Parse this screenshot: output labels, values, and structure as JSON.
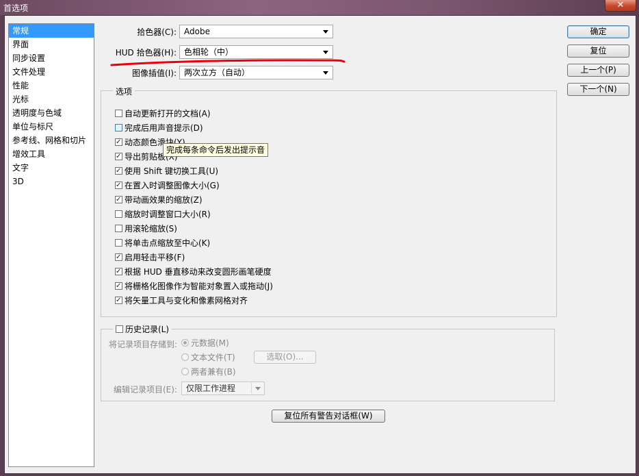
{
  "window": {
    "title": "首选项",
    "close_glyph": "✕"
  },
  "nav": {
    "items": [
      "常规",
      "界面",
      "同步设置",
      "文件处理",
      "性能",
      "光标",
      "透明度与色域",
      "单位与标尺",
      "参考线、网格和切片",
      "增效工具",
      "文字",
      "3D"
    ],
    "selected": 0
  },
  "general": {
    "color_picker": {
      "label": "拾色器(C):",
      "value": "Adobe"
    },
    "hud_picker": {
      "label": "HUD 拾色器(H):",
      "value": "色相轮（中）"
    },
    "interpolation": {
      "label": "图像插值(I):",
      "value": "两次立方（自动）"
    }
  },
  "options": {
    "title": "选项",
    "checks": [
      {
        "label": "自动更新打开的文档(A)",
        "checked": false
      },
      {
        "label": "完成后用声音提示(D)",
        "checked": false,
        "hover": true
      },
      {
        "label": "动态颜色滑块(Y)",
        "checked": true
      },
      {
        "label": "导出剪贴板(X)",
        "checked": true
      },
      {
        "label": "使用 Shift 键切换工具(U)",
        "checked": true
      },
      {
        "label": "在置入时调整图像大小(G)",
        "checked": true
      },
      {
        "label": "带动画效果的缩放(Z)",
        "checked": true
      },
      {
        "label": "缩放时调整窗口大小(R)",
        "checked": false
      },
      {
        "label": "用滚轮缩放(S)",
        "checked": false
      },
      {
        "label": "将单击点缩放至中心(K)",
        "checked": false
      },
      {
        "label": "启用轻击平移(F)",
        "checked": true
      },
      {
        "label": "根据 HUD 垂直移动来改变圆形画笔硬度",
        "checked": true
      },
      {
        "label": "将栅格化图像作为智能对象置入或拖动(J)",
        "checked": true
      },
      {
        "label": "将矢量工具与变化和像素网格对齐",
        "checked": true
      }
    ],
    "tooltip": "完成每条命令后发出提示音"
  },
  "history": {
    "label": "历史记录(L)",
    "checked": false,
    "save_to_label": "将记录项目存储到:",
    "radios": [
      {
        "label": "元数据(M)",
        "on": true
      },
      {
        "label": "文本文件(T)",
        "on": false
      },
      {
        "label": "两者兼有(B)",
        "on": false
      }
    ],
    "choose_button": "选取(O)...",
    "edit_label": "编辑记录项目(E):",
    "edit_value": "仅限工作进程"
  },
  "reset_warnings": "复位所有警告对话框(W)",
  "buttons": {
    "ok": "确定",
    "reset": "复位",
    "prev": "上一个(P)",
    "next": "下一个(N)"
  },
  "colors": {
    "selection": "#3399ff",
    "annotation": "#e8000f",
    "tooltip_bg": "#ffffe1"
  }
}
